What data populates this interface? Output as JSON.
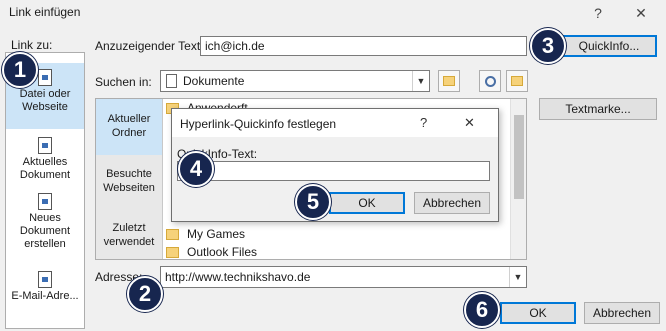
{
  "window": {
    "title": "Link einfügen",
    "help_glyph": "?",
    "close_glyph": "✕"
  },
  "link_to": {
    "label": "Link zu:",
    "items": [
      {
        "label_line1": "Datei oder",
        "label_line2": "Webseite"
      },
      {
        "label_line1": "Aktuelles",
        "label_line2": "Dokument"
      },
      {
        "label_line1": "Neues",
        "label_line2": "Dokument",
        "label_line3": "erstellen"
      },
      {
        "label_line1": "E-Mail-Adre..."
      }
    ]
  },
  "display_text": {
    "label": "Anzuzeigender Text:",
    "value": "ich@ich.de"
  },
  "quickinfo_button": {
    "label": "QuickInfo..."
  },
  "search_in": {
    "label": "Suchen in:",
    "value": "Dokumente"
  },
  "tabs": [
    {
      "line1": "Aktueller",
      "line2": "Ordner"
    },
    {
      "line1": "Besuchte",
      "line2": "Webseiten"
    },
    {
      "line1": "Zuletzt",
      "line2": "verwendet"
    }
  ],
  "files": [
    {
      "name": "Anwenderft..."
    },
    {
      "name": "My Games"
    },
    {
      "name": "Outlook Files"
    }
  ],
  "textmarke_button": {
    "label": "Textmarke..."
  },
  "address": {
    "label": "Adresse:",
    "value": "http://www.technikshavo.de"
  },
  "ok_button": {
    "label": "OK"
  },
  "cancel_button": {
    "label": "Abbrechen"
  },
  "quickinfo_dialog": {
    "title": "Hyperlink-Quickinfo festlegen",
    "help_glyph": "?",
    "close_glyph": "✕",
    "field_label": "QuickInfo-Text:",
    "field_value": "",
    "ok_label": "OK",
    "cancel_label": "Abbrechen"
  },
  "markers": [
    "1",
    "2",
    "3",
    "4",
    "5",
    "6"
  ]
}
